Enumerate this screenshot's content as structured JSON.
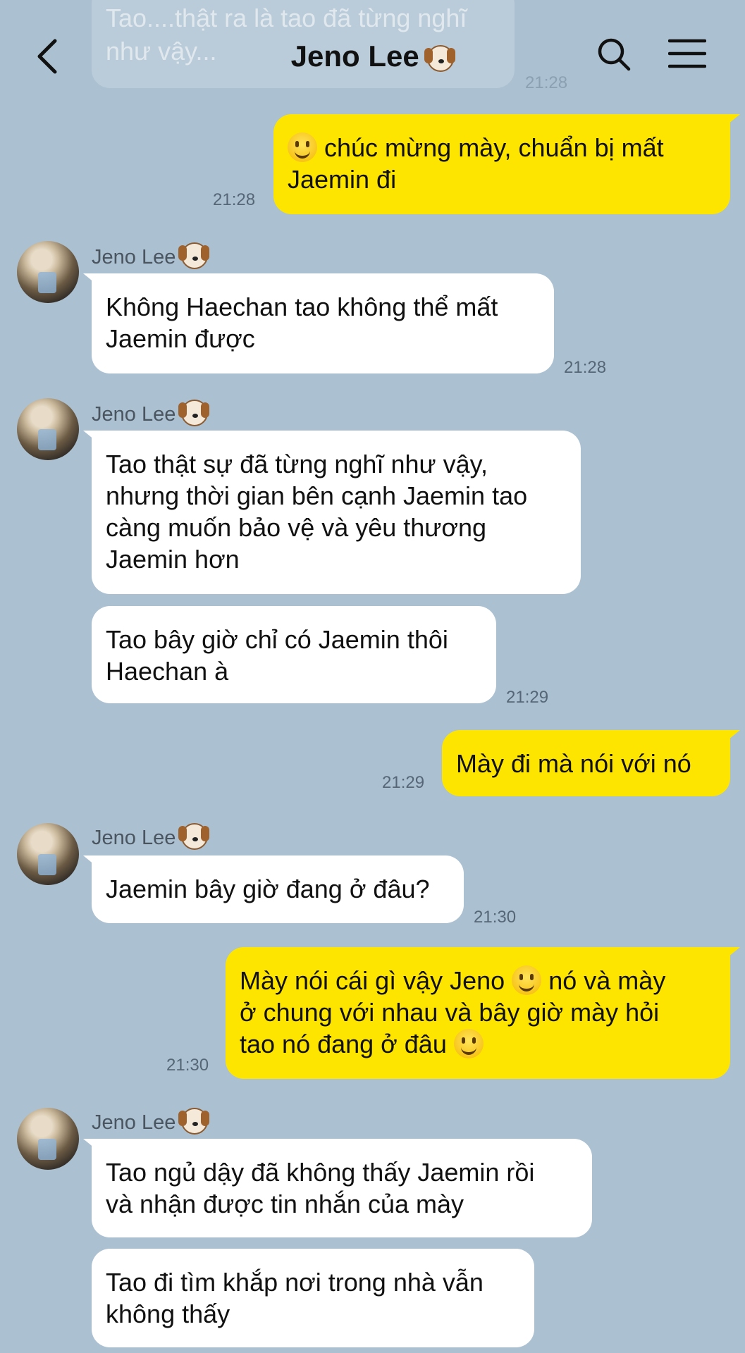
{
  "header": {
    "title": "Jeno Lee",
    "faded_prev_message": [
      "Tao....thật ra là tao đã từng nghĩ",
      "như vậy..."
    ],
    "faded_prev_time": "21:28",
    "icons": {
      "back": "back-chevron-icon",
      "search": "search-icon",
      "menu": "menu-icon",
      "title_emoji": "dog-emoji-icon"
    }
  },
  "messages": [
    {
      "side": "out",
      "lines": [
        "chúc mừng mày, chuẩn bị mất",
        "Jaemin đi"
      ],
      "time": "21:28"
    },
    {
      "side": "in",
      "sender": "Jeno Lee",
      "lines": [
        "Không Haechan tao không thể mất",
        "Jaemin được"
      ],
      "time": "21:28"
    },
    {
      "side": "in",
      "sender": "Jeno Lee",
      "lines": [
        "Tao thật sự đã từng nghĩ như vậy,",
        "nhưng thời gian bên cạnh Jaemin tao",
        "càng muốn bảo vệ và yêu thương",
        "Jaemin hơn"
      ]
    },
    {
      "side": "in",
      "lines": [
        "Tao bây giờ chỉ có Jaemin thôi",
        "Haechan à"
      ],
      "time": "21:29"
    },
    {
      "side": "out",
      "lines": [
        "Mày đi mà nói với nó"
      ],
      "time": "21:29"
    },
    {
      "side": "in",
      "sender": "Jeno Lee",
      "lines": [
        "Jaemin bây giờ đang ở đâu?"
      ],
      "time": "21:30"
    },
    {
      "side": "out",
      "lines": [
        "Mày nói cái gì vậy Jeno",
        "nó và mày",
        "ở chung với nhau và bây giờ mày hỏi",
        "tao nó đang ở đâu"
      ],
      "time": "21:30"
    },
    {
      "side": "in",
      "sender": "Jeno Lee",
      "lines": [
        "Tao ngủ dậy đã không thấy Jaemin rồi",
        "và nhận được tin nhắn của mày"
      ]
    },
    {
      "side": "in",
      "lines": [
        "Tao đi tìm khắp nơi trong nhà vẫn",
        "không thấy"
      ]
    }
  ],
  "colors": {
    "background": "#abc1d1",
    "outgoing_bubble": "#fee500",
    "incoming_bubble": "#ffffff"
  }
}
